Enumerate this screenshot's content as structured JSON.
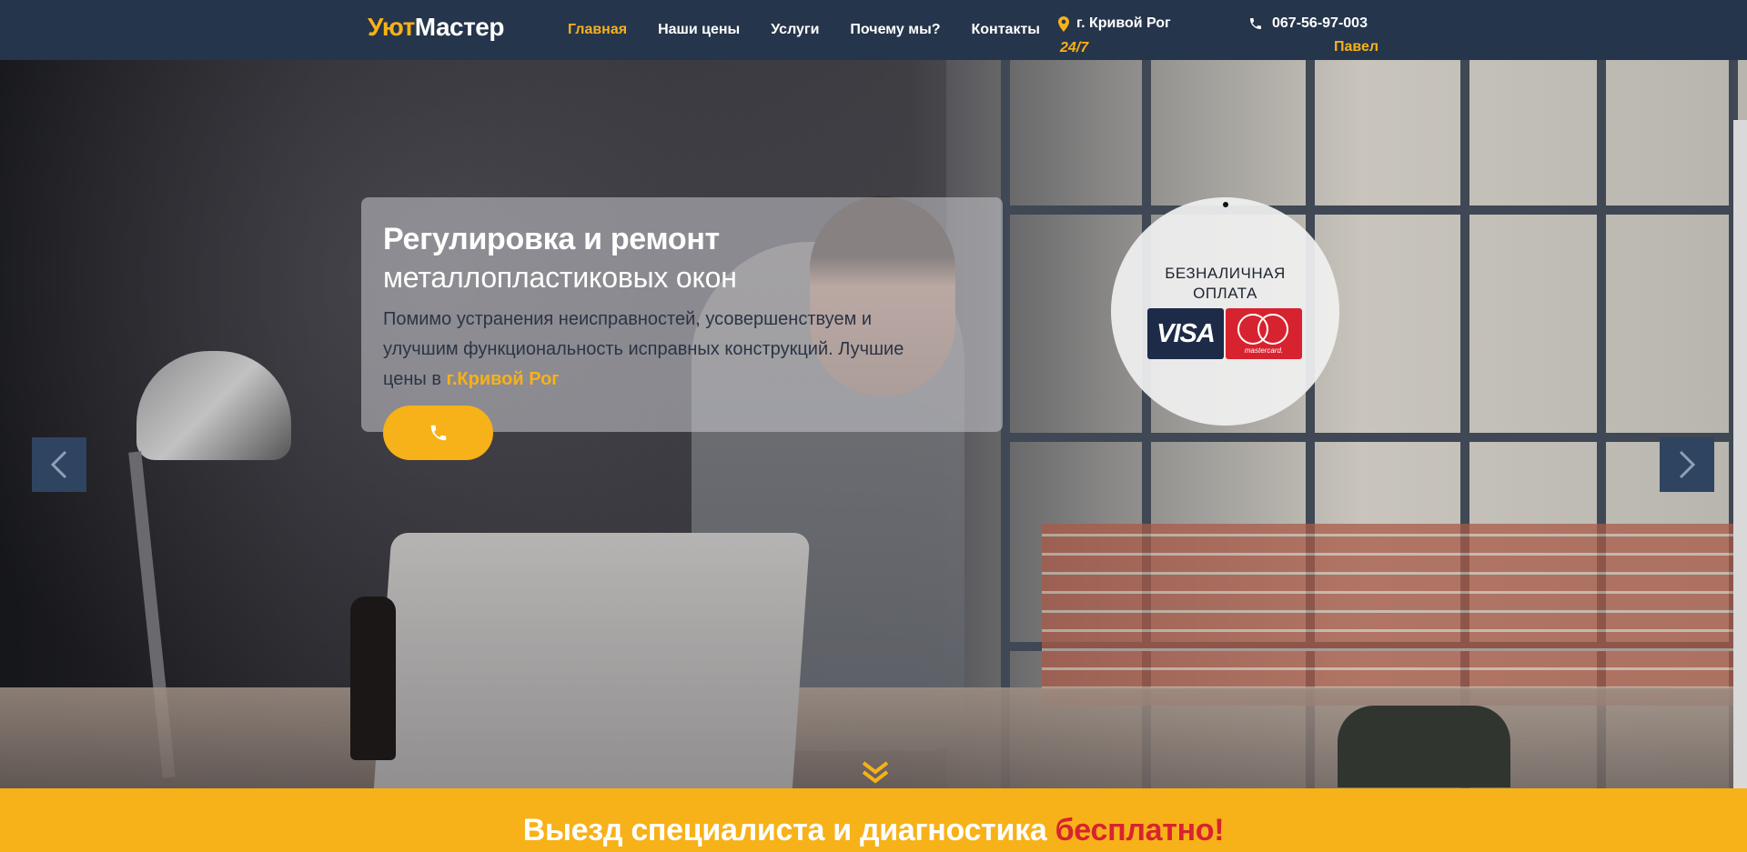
{
  "header": {
    "logo_part1": "Уют",
    "logo_part2": "Мастер",
    "nav": [
      {
        "label": "Главная",
        "active": true
      },
      {
        "label": "Наши цены",
        "active": false
      },
      {
        "label": "Услуги",
        "active": false
      },
      {
        "label": "Почему мы?",
        "active": false
      },
      {
        "label": "Контакты",
        "active": false
      }
    ],
    "city": "г. Кривой Рог",
    "hours": "24/7",
    "phone": "067-56-97-003",
    "contact_name": "Павел"
  },
  "hero": {
    "title_bold": "Регулировка и ремонт",
    "title_light": "металлопластиковых окон",
    "description": "Помимо устранения неисправностей, усовершенствуем и улучшим функциональность исправных конструкций. Лучшие цены в",
    "description_highlight": "г.Кривой Рог",
    "call_button_icon": "phone-icon"
  },
  "payment": {
    "line1": "БЕЗНАЛИЧНАЯ",
    "line2": "ОПЛАТА",
    "visa_label": "VISA",
    "mastercard_label": "mastercard."
  },
  "promo": {
    "text": "Выезд специалиста и диагностика",
    "highlight": "бесплатно!"
  },
  "colors": {
    "accent": "#f7b119",
    "header_bg": "#25354b",
    "highlight_red": "#d7232f"
  }
}
